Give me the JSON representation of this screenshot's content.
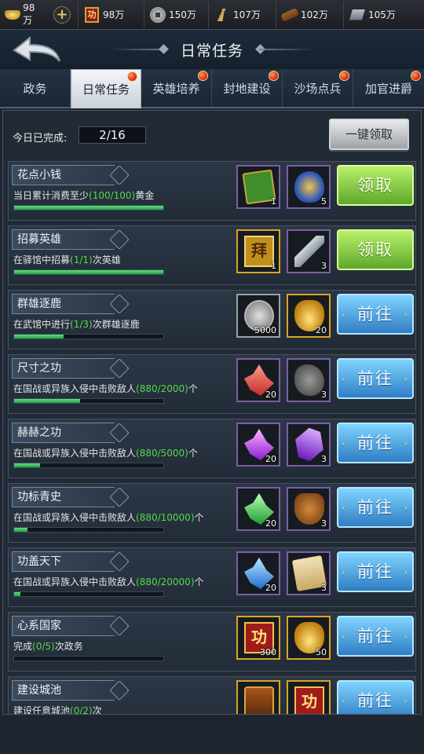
{
  "resources": [
    {
      "icon": "gold-ingot-icon",
      "value": "98万"
    },
    {
      "icon": "merit-icon",
      "value": "98万"
    },
    {
      "icon": "copper-coin-icon",
      "value": "150万"
    },
    {
      "icon": "grain-icon",
      "value": "107万"
    },
    {
      "icon": "wood-icon",
      "value": "102万"
    },
    {
      "icon": "iron-icon",
      "value": "105万"
    }
  ],
  "header": {
    "title": "日常任务"
  },
  "tabs": [
    {
      "label": "政务",
      "dot": false
    },
    {
      "label": "日常任务",
      "dot": true,
      "active": true
    },
    {
      "label": "英雄培养",
      "dot": true
    },
    {
      "label": "封地建设",
      "dot": true
    },
    {
      "label": "沙场点兵",
      "dot": true
    },
    {
      "label": "加官进爵",
      "dot": true
    }
  ],
  "summary": {
    "completed_label": "今日已完成:",
    "completed_value": "2/16",
    "claim_all_label": "一键领取"
  },
  "tasks": [
    {
      "title": "花点小钱",
      "desc_before": "当日累计消费至少",
      "desc_progress": "(100/100)",
      "desc_after": "黄金",
      "progress": 1.0,
      "action": "领取",
      "action_type": "claim",
      "rewards": [
        {
          "icon": "command-token-icon",
          "qty": "1"
        },
        {
          "icon": "mystery-bag-icon",
          "qty": "5"
        }
      ]
    },
    {
      "title": "招募英雄",
      "desc_before": "在驿馆中招募",
      "desc_progress": "(1/1)",
      "desc_after": "次英雄",
      "progress": 1.0,
      "action": "领取",
      "action_type": "claim",
      "rewards": [
        {
          "icon": "recruit-scroll-icon",
          "qty": "1",
          "text": "拜"
        },
        {
          "icon": "sword-icon",
          "qty": "3"
        }
      ]
    },
    {
      "title": "群雄逐鹿",
      "desc_before": "在武馆中进行",
      "desc_progress": "(1/3)",
      "desc_after": "次群雄逐鹿",
      "progress": 0.333,
      "action": "前往",
      "action_type": "go",
      "rewards": [
        {
          "icon": "copper-coin-icon",
          "qty": "5000"
        },
        {
          "icon": "gold-ingot-icon",
          "qty": "20"
        }
      ]
    },
    {
      "title": "尺寸之功",
      "desc_before": "在国战或异族入侵中击败敌人",
      "desc_progress": "(880/2000)",
      "desc_after": "个",
      "progress": 0.44,
      "action": "前往",
      "action_type": "go",
      "rewards": [
        {
          "icon": "red-crystal-icon",
          "qty": "20"
        },
        {
          "icon": "iron-ore-icon",
          "qty": "3"
        }
      ]
    },
    {
      "title": "赫赫之功",
      "desc_before": "在国战或异族入侵中击败敌人",
      "desc_progress": "(880/5000)",
      "desc_after": "个",
      "progress": 0.176,
      "action": "前往",
      "action_type": "go",
      "rewards": [
        {
          "icon": "purple-crystal-icon",
          "qty": "20"
        },
        {
          "icon": "purple-gem-icon",
          "qty": "3"
        }
      ]
    },
    {
      "title": "功标青史",
      "desc_before": "在国战或异族入侵中击败敌人",
      "desc_progress": "(880/10000)",
      "desc_after": "个",
      "progress": 0.088,
      "action": "前往",
      "action_type": "go",
      "rewards": [
        {
          "icon": "green-crystal-icon",
          "qty": "20"
        },
        {
          "icon": "saddle-icon",
          "qty": "3"
        }
      ]
    },
    {
      "title": "功盖天下",
      "desc_before": "在国战或异族入侵中击败敌人",
      "desc_progress": "(880/20000)",
      "desc_after": "个",
      "progress": 0.044,
      "action": "前往",
      "action_type": "go",
      "rewards": [
        {
          "icon": "blue-crystal-icon",
          "qty": "20"
        },
        {
          "icon": "paper-scroll-icon",
          "qty": "3"
        }
      ]
    },
    {
      "title": "心系国家",
      "desc_before": "完成",
      "desc_progress": "(0/5)",
      "desc_after": "次政务",
      "progress": 0.0,
      "action": "前往",
      "action_type": "go",
      "rewards": [
        {
          "icon": "merit-banner-icon",
          "qty": "300",
          "text": "功"
        },
        {
          "icon": "gold-ingot-icon",
          "qty": "50"
        }
      ]
    },
    {
      "title": "建设城池",
      "desc_before": "建设任意城池",
      "desc_progress": "(0/2)",
      "desc_after": "次",
      "progress": 0.0,
      "action": "前往",
      "action_type": "go",
      "rewards": [
        {
          "icon": "treasure-chest-icon",
          "qty": ""
        },
        {
          "icon": "merit-banner-icon",
          "qty": "",
          "text": "功"
        }
      ]
    }
  ]
}
